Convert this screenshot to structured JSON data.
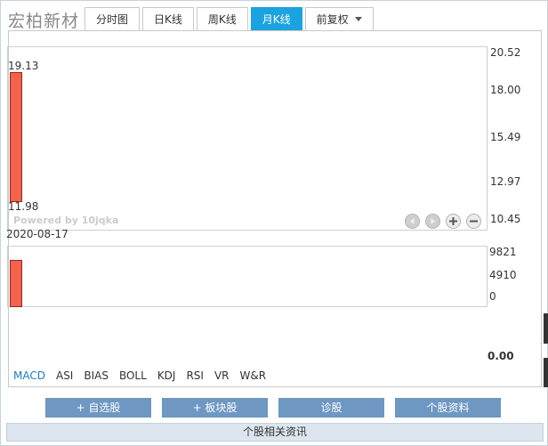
{
  "stock": {
    "name": "宏柏新材"
  },
  "tabs": [
    {
      "label": "分时图",
      "active": false
    },
    {
      "label": "日K线",
      "active": false
    },
    {
      "label": "周K线",
      "active": false
    },
    {
      "label": "月K线",
      "active": true
    },
    {
      "label": "前复权",
      "active": false,
      "dropdown": true
    }
  ],
  "colors": {
    "accent": "#1aa3e0",
    "candle_up": "#f4614c",
    "button": "#6e97c2",
    "indicator_active": "#1a7fc1"
  },
  "chart": {
    "price_axis": [
      "20.52",
      "18.00",
      "15.49",
      "12.97",
      "10.45"
    ],
    "high_label": "19.13",
    "low_label": "11.98",
    "date_label": "2020-08-17",
    "watermark": "Powered by 10jqka",
    "volume_axis": [
      "9821",
      "4910",
      "0"
    ],
    "indicator_zero": "0.00",
    "controls": [
      "left-arrow-icon",
      "right-arrow-icon",
      "zoom-in-icon",
      "zoom-out-icon"
    ]
  },
  "chart_data": {
    "type": "bar",
    "categories": [
      "2020-08-17"
    ],
    "candles": [
      {
        "date": "2020-08-17",
        "high": 19.13,
        "low": 11.98
      }
    ],
    "volume": [
      9821
    ],
    "ylim": [
      10.45,
      20.52
    ],
    "volume_ylim": [
      0,
      9821
    ]
  },
  "indicators": [
    "MACD",
    "ASI",
    "BIAS",
    "BOLL",
    "KDJ",
    "RSI",
    "VR",
    "W&R"
  ],
  "active_indicator": "MACD",
  "actions": [
    "+ 自选股",
    "+ 板块股",
    "诊股",
    "个股资料"
  ],
  "news_bar": {
    "label": "个股相关资讯"
  }
}
